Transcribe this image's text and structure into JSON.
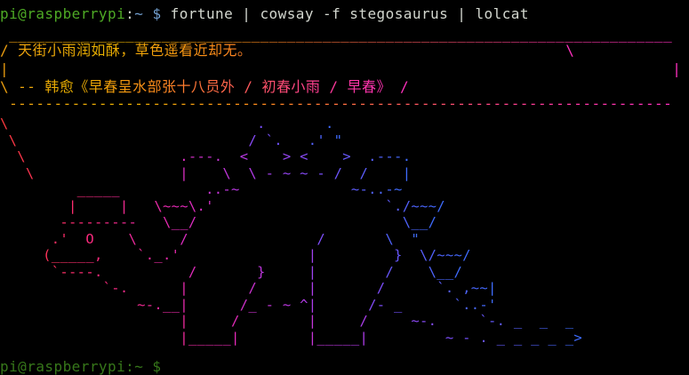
{
  "terminal": {
    "prompt": {
      "user_host": "pi@raspberrypi",
      "colon": ":",
      "path": "~",
      "dollar": "$",
      "command": "fortune | cowsay -f stegosaurus | lolcat"
    },
    "bubble": {
      "top": " __________________________________________________________________________",
      "line1": "/ 天街小雨润如酥，草色遥看近却无。                                   \\",
      "line2": "|                                                                          |",
      "line3": "\\ -- 韩愈《早春呈水部张十八员外 / 初春小雨 / 早春》 /",
      "bottom": " --------------------------------------------------------------------------"
    },
    "art": [
      "\\                             .       .",
      " \\                           / `.   .' \"",
      "  \\                  .---.  <    > <    >  .---.",
      "   \\                 |    \\  \\ - ~ ~ - /  /    |",
      "         _____          ..-~             ~-..-~",
      "        |     |   \\~~~\\.'                    `./~~~/",
      "       ---------   \\__/                        \\__/",
      "      .'  O    \\     /               /       \\  \"",
      "     (_____,    `._.'               |         }  \\/~~~/",
      "      `----.          /       }     |        /    \\__/",
      "            `-.      |       /      |       /      `. ,~~|",
      "                ~-.__|      /_ - ~ ^|      /- _      `..-'",
      "                     |     /        |     /     ~-.     `-. _  _  _",
      "                     |_____|        |_____|         ~ - . _ _ _ _ _>"
    ],
    "next_prompt": "pi@raspberrypi:~ $"
  },
  "colors": {
    "background": "#000000",
    "prompt_user": "#4eaa25",
    "prompt_path": "#729fcf",
    "command_text": "#d3d7cf",
    "bubble_gradient_start": "#f0a010",
    "bubble_gradient_end": "#ff2fc0",
    "art_gradient_start": "#ff3a3a",
    "art_gradient_end": "#3c6dff"
  }
}
